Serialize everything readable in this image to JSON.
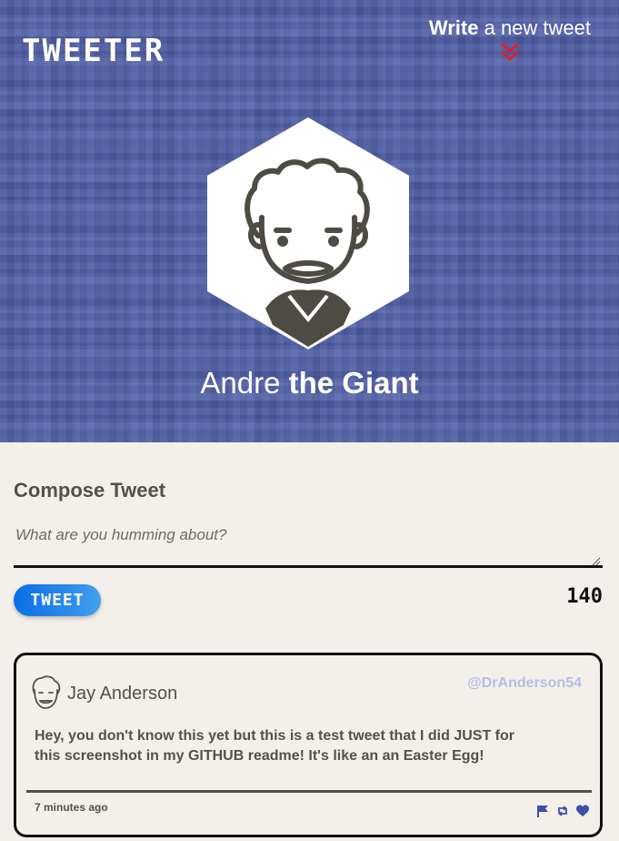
{
  "header": {
    "logo": "TWEETER",
    "nav": {
      "bold": "Write",
      "rest": "a new tweet"
    }
  },
  "profile": {
    "name_first": "Andre",
    "name_bold": "the Giant"
  },
  "compose": {
    "title": "Compose Tweet",
    "placeholder": "What are you humming about?",
    "button_label": "TWEET",
    "counter": "140"
  },
  "tweets": [
    {
      "name": "Jay Anderson",
      "handle": "@DrAnderson54",
      "text": "Hey, you don't know this yet but this is a test tweet that I did JUST for this screenshot in my GITHUB readme! It's like an an Easter Egg!",
      "time": "7 minutes ago",
      "actions": [
        "flag-icon",
        "retweet-icon",
        "heart-icon"
      ]
    }
  ],
  "colors": {
    "header_bg": "#4f5ea8",
    "page_bg": "#f3f0eb",
    "button_blue": "#0a6ee6",
    "chevron_red": "#e0202a",
    "handle_color": "#b8bde0",
    "icon_blue": "#3d50a8"
  }
}
